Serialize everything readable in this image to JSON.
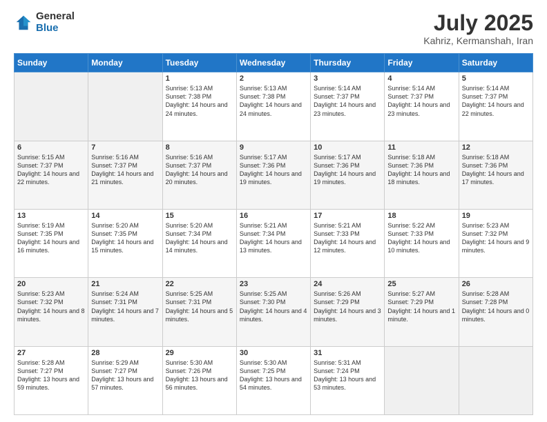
{
  "header": {
    "logo_general": "General",
    "logo_blue": "Blue",
    "month": "July 2025",
    "location": "Kahriz, Kermanshah, Iran"
  },
  "weekdays": [
    "Sunday",
    "Monday",
    "Tuesday",
    "Wednesday",
    "Thursday",
    "Friday",
    "Saturday"
  ],
  "weeks": [
    [
      {
        "day": "",
        "sunrise": "",
        "sunset": "",
        "daylight": ""
      },
      {
        "day": "",
        "sunrise": "",
        "sunset": "",
        "daylight": ""
      },
      {
        "day": "1",
        "sunrise": "Sunrise: 5:13 AM",
        "sunset": "Sunset: 7:38 PM",
        "daylight": "Daylight: 14 hours and 24 minutes."
      },
      {
        "day": "2",
        "sunrise": "Sunrise: 5:13 AM",
        "sunset": "Sunset: 7:38 PM",
        "daylight": "Daylight: 14 hours and 24 minutes."
      },
      {
        "day": "3",
        "sunrise": "Sunrise: 5:14 AM",
        "sunset": "Sunset: 7:37 PM",
        "daylight": "Daylight: 14 hours and 23 minutes."
      },
      {
        "day": "4",
        "sunrise": "Sunrise: 5:14 AM",
        "sunset": "Sunset: 7:37 PM",
        "daylight": "Daylight: 14 hours and 23 minutes."
      },
      {
        "day": "5",
        "sunrise": "Sunrise: 5:14 AM",
        "sunset": "Sunset: 7:37 PM",
        "daylight": "Daylight: 14 hours and 22 minutes."
      }
    ],
    [
      {
        "day": "6",
        "sunrise": "Sunrise: 5:15 AM",
        "sunset": "Sunset: 7:37 PM",
        "daylight": "Daylight: 14 hours and 22 minutes."
      },
      {
        "day": "7",
        "sunrise": "Sunrise: 5:16 AM",
        "sunset": "Sunset: 7:37 PM",
        "daylight": "Daylight: 14 hours and 21 minutes."
      },
      {
        "day": "8",
        "sunrise": "Sunrise: 5:16 AM",
        "sunset": "Sunset: 7:37 PM",
        "daylight": "Daylight: 14 hours and 20 minutes."
      },
      {
        "day": "9",
        "sunrise": "Sunrise: 5:17 AM",
        "sunset": "Sunset: 7:36 PM",
        "daylight": "Daylight: 14 hours and 19 minutes."
      },
      {
        "day": "10",
        "sunrise": "Sunrise: 5:17 AM",
        "sunset": "Sunset: 7:36 PM",
        "daylight": "Daylight: 14 hours and 19 minutes."
      },
      {
        "day": "11",
        "sunrise": "Sunrise: 5:18 AM",
        "sunset": "Sunset: 7:36 PM",
        "daylight": "Daylight: 14 hours and 18 minutes."
      },
      {
        "day": "12",
        "sunrise": "Sunrise: 5:18 AM",
        "sunset": "Sunset: 7:36 PM",
        "daylight": "Daylight: 14 hours and 17 minutes."
      }
    ],
    [
      {
        "day": "13",
        "sunrise": "Sunrise: 5:19 AM",
        "sunset": "Sunset: 7:35 PM",
        "daylight": "Daylight: 14 hours and 16 minutes."
      },
      {
        "day": "14",
        "sunrise": "Sunrise: 5:20 AM",
        "sunset": "Sunset: 7:35 PM",
        "daylight": "Daylight: 14 hours and 15 minutes."
      },
      {
        "day": "15",
        "sunrise": "Sunrise: 5:20 AM",
        "sunset": "Sunset: 7:34 PM",
        "daylight": "Daylight: 14 hours and 14 minutes."
      },
      {
        "day": "16",
        "sunrise": "Sunrise: 5:21 AM",
        "sunset": "Sunset: 7:34 PM",
        "daylight": "Daylight: 14 hours and 13 minutes."
      },
      {
        "day": "17",
        "sunrise": "Sunrise: 5:21 AM",
        "sunset": "Sunset: 7:33 PM",
        "daylight": "Daylight: 14 hours and 12 minutes."
      },
      {
        "day": "18",
        "sunrise": "Sunrise: 5:22 AM",
        "sunset": "Sunset: 7:33 PM",
        "daylight": "Daylight: 14 hours and 10 minutes."
      },
      {
        "day": "19",
        "sunrise": "Sunrise: 5:23 AM",
        "sunset": "Sunset: 7:32 PM",
        "daylight": "Daylight: 14 hours and 9 minutes."
      }
    ],
    [
      {
        "day": "20",
        "sunrise": "Sunrise: 5:23 AM",
        "sunset": "Sunset: 7:32 PM",
        "daylight": "Daylight: 14 hours and 8 minutes."
      },
      {
        "day": "21",
        "sunrise": "Sunrise: 5:24 AM",
        "sunset": "Sunset: 7:31 PM",
        "daylight": "Daylight: 14 hours and 7 minutes."
      },
      {
        "day": "22",
        "sunrise": "Sunrise: 5:25 AM",
        "sunset": "Sunset: 7:31 PM",
        "daylight": "Daylight: 14 hours and 5 minutes."
      },
      {
        "day": "23",
        "sunrise": "Sunrise: 5:25 AM",
        "sunset": "Sunset: 7:30 PM",
        "daylight": "Daylight: 14 hours and 4 minutes."
      },
      {
        "day": "24",
        "sunrise": "Sunrise: 5:26 AM",
        "sunset": "Sunset: 7:29 PM",
        "daylight": "Daylight: 14 hours and 3 minutes."
      },
      {
        "day": "25",
        "sunrise": "Sunrise: 5:27 AM",
        "sunset": "Sunset: 7:29 PM",
        "daylight": "Daylight: 14 hours and 1 minute."
      },
      {
        "day": "26",
        "sunrise": "Sunrise: 5:28 AM",
        "sunset": "Sunset: 7:28 PM",
        "daylight": "Daylight: 14 hours and 0 minutes."
      }
    ],
    [
      {
        "day": "27",
        "sunrise": "Sunrise: 5:28 AM",
        "sunset": "Sunset: 7:27 PM",
        "daylight": "Daylight: 13 hours and 59 minutes."
      },
      {
        "day": "28",
        "sunrise": "Sunrise: 5:29 AM",
        "sunset": "Sunset: 7:27 PM",
        "daylight": "Daylight: 13 hours and 57 minutes."
      },
      {
        "day": "29",
        "sunrise": "Sunrise: 5:30 AM",
        "sunset": "Sunset: 7:26 PM",
        "daylight": "Daylight: 13 hours and 56 minutes."
      },
      {
        "day": "30",
        "sunrise": "Sunrise: 5:30 AM",
        "sunset": "Sunset: 7:25 PM",
        "daylight": "Daylight: 13 hours and 54 minutes."
      },
      {
        "day": "31",
        "sunrise": "Sunrise: 5:31 AM",
        "sunset": "Sunset: 7:24 PM",
        "daylight": "Daylight: 13 hours and 53 minutes."
      },
      {
        "day": "",
        "sunrise": "",
        "sunset": "",
        "daylight": ""
      },
      {
        "day": "",
        "sunrise": "",
        "sunset": "",
        "daylight": ""
      }
    ]
  ]
}
